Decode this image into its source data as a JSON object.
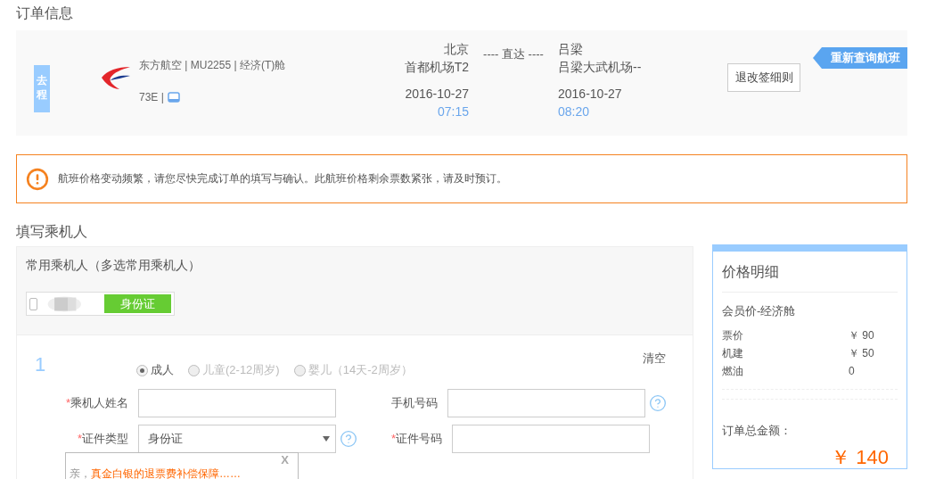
{
  "order_section": {
    "title": "订单信息"
  },
  "flight": {
    "direction_tag": "去程",
    "airline_info": "东方航空 | MU2255 | 经济(T)舱",
    "aircraft": "73E |",
    "departure": {
      "city": "北京",
      "airport": "首都机场T2",
      "date": "2016-10-27",
      "time": "07:15"
    },
    "route_type": "---- 直达 ----",
    "arrival": {
      "city": "吕梁",
      "airport": "吕梁大武机场--",
      "date": "2016-10-27",
      "time": "08:20"
    },
    "rules_button": "退改签细则",
    "requery_button": "重新查询航班"
  },
  "alert": {
    "message": "航班价格变动频繁，请您尽快完成订单的填写与确认。此航班价格剩余票数紧张，请及时预订。"
  },
  "passenger_section": {
    "title": "填写乘机人",
    "frequent_label": "常用乘机人（多选常用乘机人）",
    "frequent_passengers": [
      {
        "id_type": "身份证",
        "checked": false
      }
    ]
  },
  "passenger_form": {
    "number": "1",
    "clear_button": "清空",
    "required_mark": "*",
    "types": [
      {
        "label": "成人",
        "selected": true,
        "disabled": false
      },
      {
        "label": "儿童(2-12周岁)",
        "selected": false,
        "disabled": true
      },
      {
        "label": "婴儿（14天-2周岁）",
        "selected": false,
        "disabled": true
      }
    ],
    "rows": [
      [
        {
          "kind": "input",
          "label": "乘机人姓名",
          "required": true,
          "help": false
        },
        {
          "kind": "input",
          "label": "手机号码",
          "required": false,
          "help": true
        }
      ],
      [
        {
          "kind": "select",
          "label": "证件类型",
          "required": true,
          "help": true,
          "value": "身份证"
        },
        {
          "kind": "input",
          "label": "证件号码",
          "required": true,
          "help": false
        }
      ]
    ]
  },
  "price": {
    "title": "价格明细",
    "cabin": "会员价-经济舱",
    "items": [
      {
        "label": "票价",
        "value": "￥ 90"
      },
      {
        "label": "机建",
        "value": "￥ 50"
      },
      {
        "label": "燃油",
        "value": "0"
      }
    ],
    "total_label": "订单总金额：",
    "total": "￥ 140"
  },
  "popup": {
    "close": "X",
    "lead": "亲，",
    "message": "真金白银的退票费补偿保障……"
  }
}
